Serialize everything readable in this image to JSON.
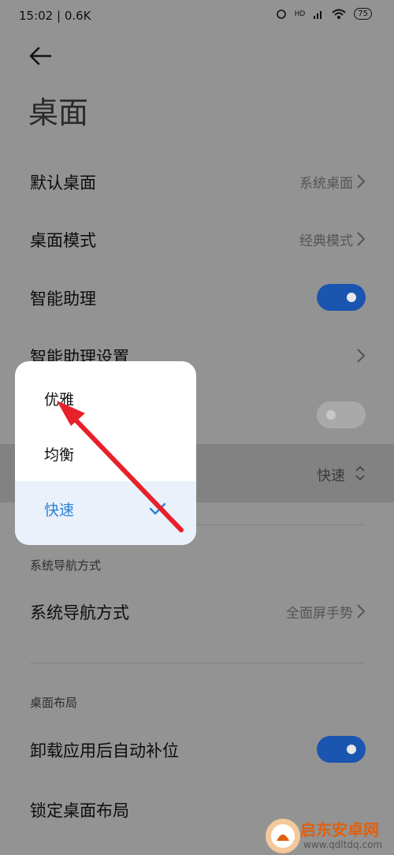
{
  "status_bar": {
    "time_speed": "15:02 | 0.6K",
    "network": "HD",
    "battery": "75"
  },
  "page": {
    "title": "桌面"
  },
  "settings": {
    "default_launcher": {
      "label": "默认桌面",
      "value": "系统桌面"
    },
    "launcher_mode": {
      "label": "桌面模式",
      "value": "经典模式"
    },
    "smart_assistant": {
      "label": "智能助理",
      "enabled": true
    },
    "smart_assistant_settings": {
      "label": "智能助理设置"
    },
    "hidden_toggle": {
      "enabled": false
    },
    "animation_speed": {
      "value": "快速"
    }
  },
  "popup": {
    "options": [
      "优雅",
      "均衡",
      "快速"
    ],
    "selected": "快速"
  },
  "navigation_section": {
    "header": "系统导航方式",
    "row": {
      "label": "系统导航方式",
      "value": "全面屏手势"
    }
  },
  "layout_section": {
    "header": "桌面布局",
    "auto_fill": {
      "label": "卸载应用后自动补位",
      "enabled": true
    },
    "lock_layout": {
      "label": "锁定桌面布局"
    }
  },
  "watermark": {
    "title": "启东安卓网",
    "url": "www.qdltdq.com"
  },
  "colors": {
    "accent": "#1a55b0",
    "selected_text": "#2b83d6",
    "annotation_arrow": "#e8202a"
  }
}
